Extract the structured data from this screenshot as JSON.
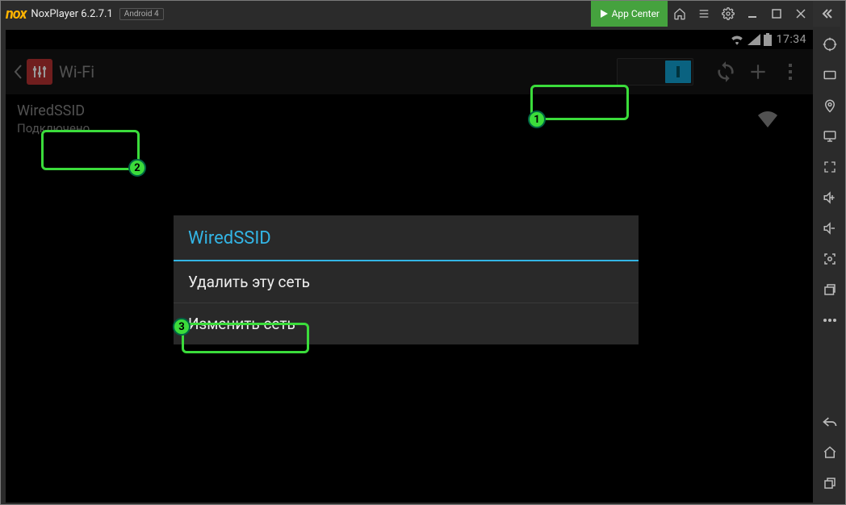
{
  "titlebar": {
    "logo_text": "nox",
    "app_name": "NoxPlayer 6.2.7.1",
    "android_badge": "Android 4",
    "app_center_label": "App Center"
  },
  "android": {
    "status_time": "17:34",
    "wifi_title": "Wi-Fi"
  },
  "network": {
    "ssid": "WiredSSID",
    "status": "Подключено"
  },
  "dialog": {
    "title": "WiredSSID",
    "forget_label": "Удалить эту сеть",
    "modify_label": "Изменить сеть"
  },
  "annotations": {
    "b1": "1",
    "b2": "2",
    "b3": "3"
  }
}
